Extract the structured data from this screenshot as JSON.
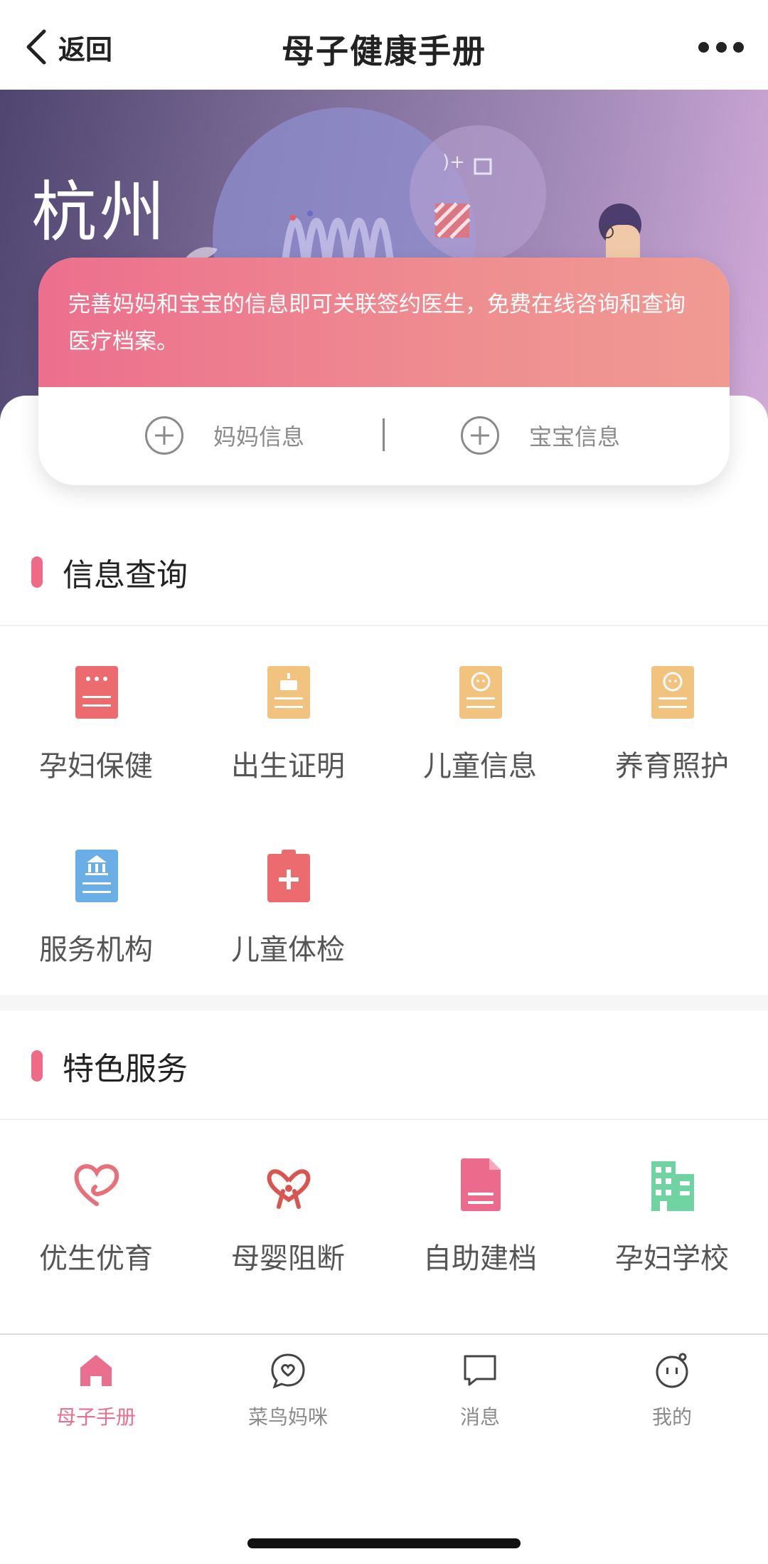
{
  "nav": {
    "back_label": "返回",
    "title": "母子健康手册",
    "more_icon": "more-dots-icon"
  },
  "banner": {
    "city": "杭州"
  },
  "profile_card": {
    "message": "完善妈妈和宝宝的信息即可关联签约医生，免费在线咨询和查询医疗档案。",
    "mom_label": "妈妈信息",
    "baby_label": "宝宝信息"
  },
  "info_section": {
    "title": "信息查询",
    "items": [
      {
        "label": "孕妇保健",
        "icon": "maternal-care-icon",
        "color": "#ec6b6e"
      },
      {
        "label": "出生证明",
        "icon": "birth-certificate-icon",
        "color": "#f2c27f"
      },
      {
        "label": "儿童信息",
        "icon": "child-info-icon",
        "color": "#f2c27f"
      },
      {
        "label": "养育照护",
        "icon": "parenting-care-icon",
        "color": "#f2c27f"
      },
      {
        "label": "服务机构",
        "icon": "institution-icon",
        "color": "#6aaee8"
      },
      {
        "label": "儿童体检",
        "icon": "child-checkup-icon",
        "color": "#ec6b6e"
      }
    ]
  },
  "feature_section": {
    "title": "特色服务",
    "items": [
      {
        "label": "优生优育",
        "icon": "heart-icon",
        "color": "#e8707a"
      },
      {
        "label": "母婴阻断",
        "icon": "ribbon-heart-icon",
        "color": "#d95550"
      },
      {
        "label": "自助建档",
        "icon": "document-icon",
        "color": "#ec6b8c"
      },
      {
        "label": "孕妇学校",
        "icon": "school-building-icon",
        "color": "#6fd3a2"
      }
    ]
  },
  "tabbar": {
    "active_color": "#ea6f8e",
    "items": [
      {
        "label": "母子手册",
        "icon": "home-icon",
        "active": true
      },
      {
        "label": "菜鸟妈咪",
        "icon": "chat-heart-icon",
        "active": false
      },
      {
        "label": "消息",
        "icon": "message-icon",
        "active": false
      },
      {
        "label": "我的",
        "icon": "profile-face-icon",
        "active": false
      }
    ]
  }
}
